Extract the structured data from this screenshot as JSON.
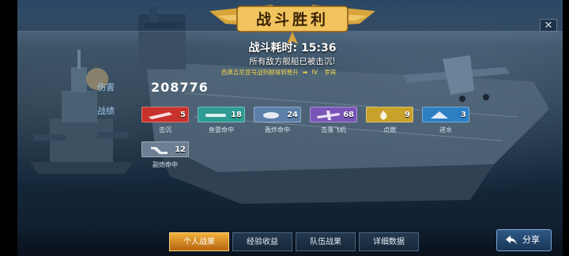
{
  "header": {
    "title": "战斗胜利",
    "close_symbol": "✕"
  },
  "summary": {
    "battle_time_label": "战斗耗时: 15:36",
    "result_text": "所有敌方舰船已被击沉!",
    "promo_text": "西弗吉尼亚号战列舰得到晋升",
    "promo_rank": "IV",
    "promo_ship": "罗宾"
  },
  "stats": {
    "damage_label": "伤害",
    "damage_value": "208776",
    "score_label": "战绩"
  },
  "medals": [
    {
      "name": "击沉",
      "count": "5",
      "color": "#c8322c",
      "icon": "sinking-icon"
    },
    {
      "name": "鱼雷命中",
      "count": "18",
      "color": "#2e9c93",
      "icon": "torpedo-icon"
    },
    {
      "name": "轰炸命中",
      "count": "24",
      "color": "#5b7fa8",
      "icon": "bomb-icon"
    },
    {
      "name": "击落飞机",
      "count": "68",
      "color": "#7a55b8",
      "icon": "plane-icon"
    },
    {
      "name": "点燃",
      "count": "9",
      "color": "#c9a22b",
      "icon": "fire-icon"
    },
    {
      "name": "进水",
      "count": "3",
      "color": "#2d7fc4",
      "icon": "flood-icon"
    },
    {
      "name": "副炮命中",
      "count": "12",
      "color": "#6d7f93",
      "icon": "secondary-gun-icon"
    }
  ],
  "tabs": [
    {
      "label": "个人战果",
      "active": true
    },
    {
      "label": "经验收益",
      "active": false
    },
    {
      "label": "队伍战果",
      "active": false
    },
    {
      "label": "详细数据",
      "active": false
    }
  ],
  "share": {
    "label": "分享",
    "icon": "share-arrow-icon"
  },
  "colors": {
    "accent_gold": "#f2b13a",
    "title_blue": "#9fc6ea",
    "promo_yellow": "#f2d54a"
  }
}
